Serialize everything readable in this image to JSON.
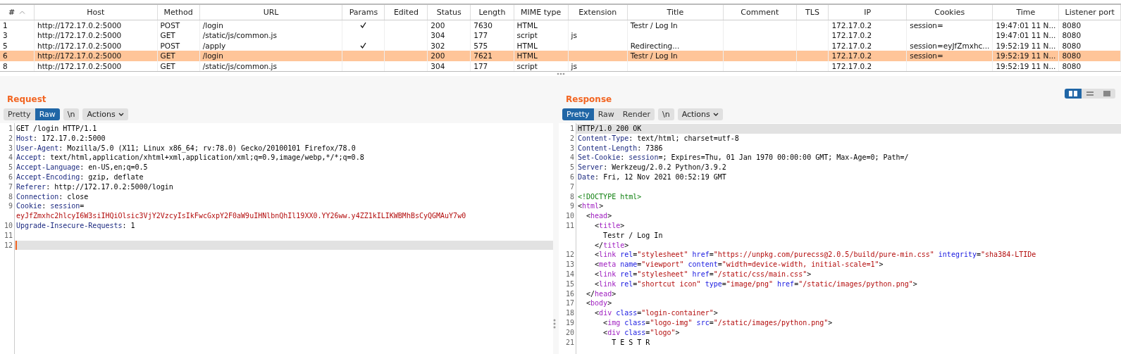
{
  "history_table": {
    "columns": [
      {
        "label": "#",
        "sorted": true
      },
      {
        "label": "Host"
      },
      {
        "label": "Method"
      },
      {
        "label": "URL"
      },
      {
        "label": "Params"
      },
      {
        "label": "Edited"
      },
      {
        "label": "Status"
      },
      {
        "label": "Length"
      },
      {
        "label": "MIME type"
      },
      {
        "label": "Extension"
      },
      {
        "label": "Title"
      },
      {
        "label": "Comment"
      },
      {
        "label": "TLS"
      },
      {
        "label": "IP"
      },
      {
        "label": "Cookies"
      },
      {
        "label": "Time"
      },
      {
        "label": "Listener port"
      }
    ],
    "rows": [
      {
        "selected": false,
        "number": "1",
        "host": "http://172.17.0.2:5000",
        "method": "POST",
        "url": "/login",
        "params": true,
        "status": "200",
        "length": "7630",
        "mime": "HTML",
        "title": "Testr / Log In",
        "ip": "172.17.0.2",
        "cookies": "session=",
        "time": "19:47:01 11 N...",
        "port": "8080"
      },
      {
        "selected": false,
        "number": "3",
        "host": "http://172.17.0.2:5000",
        "method": "GET",
        "url": "/static/js/common.js",
        "params": false,
        "status": "304",
        "length": "177",
        "mime": "script",
        "extension": "js",
        "ip": "172.17.0.2",
        "time": "19:47:01 11 N...",
        "port": "8080"
      },
      {
        "selected": false,
        "number": "5",
        "host": "http://172.17.0.2:5000",
        "method": "POST",
        "url": "/apply",
        "params": true,
        "status": "302",
        "length": "575",
        "mime": "HTML",
        "title": "Redirecting...",
        "ip": "172.17.0.2",
        "cookies": "session=eyJfZmxhc...",
        "time": "19:52:19 11 N...",
        "port": "8080"
      },
      {
        "selected": true,
        "number": "6",
        "host": "http://172.17.0.2:5000",
        "method": "GET",
        "url": "/login",
        "params": false,
        "status": "200",
        "length": "7621",
        "mime": "HTML",
        "title": "Testr / Log In",
        "ip": "172.17.0.2",
        "cookies": "session=",
        "time": "19:52:19 11 N...",
        "port": "8080"
      },
      {
        "selected": false,
        "number": "8",
        "host": "http://172.17.0.2:5000",
        "method": "GET",
        "url": "/static/js/common.js",
        "params": false,
        "status": "304",
        "length": "177",
        "mime": "script",
        "extension": "js",
        "ip": "172.17.0.2",
        "time": "19:52:19 11 N...",
        "port": "8080"
      }
    ]
  },
  "request": {
    "title": "Request",
    "view_tabs": [
      {
        "label": "Pretty",
        "selected": false
      },
      {
        "label": "Raw",
        "selected": true
      }
    ],
    "newline_button": "\\n",
    "actions_button": "Actions",
    "lines": [
      {
        "number": "1",
        "current": false,
        "segments": [
          {
            "kind": "plain",
            "text": "GET /login HTTP/1.1"
          }
        ]
      },
      {
        "number": "2",
        "current": false,
        "segments": [
          {
            "kind": "name",
            "text": "Host"
          },
          {
            "kind": "plain",
            "text": ": 172.17.0.2:5000"
          }
        ]
      },
      {
        "number": "3",
        "current": false,
        "segments": [
          {
            "kind": "name",
            "text": "User-Agent"
          },
          {
            "kind": "plain",
            "text": ": Mozilla/5.0 (X11; Linux x86_64; rv:78.0) Gecko/20100101 Firefox/78.0"
          }
        ]
      },
      {
        "number": "4",
        "current": false,
        "segments": [
          {
            "kind": "name",
            "text": "Accept"
          },
          {
            "kind": "plain",
            "text": ": text/html,application/xhtml+xml,application/xml;q=0.9,image/webp,*/*;q=0.8"
          }
        ]
      },
      {
        "number": "5",
        "current": false,
        "segments": [
          {
            "kind": "name",
            "text": "Accept-Language"
          },
          {
            "kind": "plain",
            "text": ": en-US,en;q=0.5"
          }
        ]
      },
      {
        "number": "6",
        "current": false,
        "segments": [
          {
            "kind": "name",
            "text": "Accept-Encoding"
          },
          {
            "kind": "plain",
            "text": ": gzip, deflate"
          }
        ]
      },
      {
        "number": "7",
        "current": false,
        "segments": [
          {
            "kind": "name",
            "text": "Referer"
          },
          {
            "kind": "plain",
            "text": ": http://172.17.0.2:5000/login"
          }
        ]
      },
      {
        "number": "8",
        "current": false,
        "segments": [
          {
            "kind": "name",
            "text": "Connection"
          },
          {
            "kind": "plain",
            "text": ": close"
          }
        ]
      },
      {
        "number": "9",
        "current": false,
        "segments": [
          {
            "kind": "name",
            "text": "Cookie"
          },
          {
            "kind": "plain",
            "text": ": "
          },
          {
            "kind": "name",
            "text": "session"
          },
          {
            "kind": "plain",
            "text": "="
          }
        ]
      },
      {
        "current": false,
        "segments": [
          {
            "kind": "value",
            "text": "eyJfZmxhc2hlcyI6W3siIHQiOlsic3VjY2VzcyIsIkFwcGxpY2F0aW9uIHNlbnQhIl19XX0.YY26ww.y4ZZ1kILIKWBMhBsCyQGMAuY7w0"
          }
        ]
      },
      {
        "number": "10",
        "current": false,
        "segments": [
          {
            "kind": "name",
            "text": "Upgrade-Insecure-Requests"
          },
          {
            "kind": "plain",
            "text": ": 1"
          }
        ]
      },
      {
        "number": "11",
        "current": false
      },
      {
        "number": "12",
        "current": true
      }
    ]
  },
  "response": {
    "title": "Response",
    "view_tabs": [
      {
        "label": "Pretty",
        "selected": true
      },
      {
        "label": "Raw",
        "selected": false
      },
      {
        "label": "Render",
        "selected": false
      }
    ],
    "newline_button": "\\n",
    "actions_button": "Actions",
    "layout_options": [
      {
        "kind": "columns",
        "selected": true
      },
      {
        "kind": "rows",
        "selected": false
      },
      {
        "kind": "single",
        "selected": false
      }
    ],
    "lines": [
      {
        "number": "1",
        "current": true,
        "segments": [
          {
            "kind": "plain",
            "text": "HTTP/1.0 200 OK"
          }
        ]
      },
      {
        "number": "2",
        "current": false,
        "segments": [
          {
            "kind": "name",
            "text": "Content-Type"
          },
          {
            "kind": "plain",
            "text": ": text/html; charset=utf-8"
          }
        ]
      },
      {
        "number": "3",
        "current": false,
        "segments": [
          {
            "kind": "name",
            "text": "Content-Length"
          },
          {
            "kind": "plain",
            "text": ": 7386"
          }
        ]
      },
      {
        "number": "4",
        "current": false,
        "segments": [
          {
            "kind": "name",
            "text": "Set-Cookie"
          },
          {
            "kind": "plain",
            "text": ": "
          },
          {
            "kind": "name",
            "text": "session"
          },
          {
            "kind": "plain",
            "text": "=; Expires=Thu, 01 Jan 1970 00:00:00 GMT; Max-Age=0; Path=/"
          }
        ]
      },
      {
        "number": "5",
        "current": false,
        "segments": [
          {
            "kind": "name",
            "text": "Server"
          },
          {
            "kind": "plain",
            "text": ": Werkzeug/2.0.2 Python/3.9.2"
          }
        ]
      },
      {
        "number": "6",
        "current": false,
        "segments": [
          {
            "kind": "name",
            "text": "Date"
          },
          {
            "kind": "plain",
            "text": ": Fri, 12 Nov 2021 00:52:19 GMT"
          }
        ]
      },
      {
        "number": "7",
        "current": false
      },
      {
        "number": "8",
        "current": false,
        "segments": [
          {
            "kind": "doctype",
            "text": "<!DOCTYPE html>"
          }
        ]
      },
      {
        "number": "9",
        "current": false,
        "segments": [
          {
            "kind": "plain",
            "text": "<"
          },
          {
            "kind": "tag",
            "text": "html"
          },
          {
            "kind": "plain",
            "text": ">"
          }
        ]
      },
      {
        "number": "10",
        "current": false,
        "segments": [
          {
            "kind": "plain",
            "text": "  <"
          },
          {
            "kind": "tag",
            "text": "head"
          },
          {
            "kind": "plain",
            "text": ">"
          }
        ]
      },
      {
        "number": "11",
        "current": false,
        "segments": [
          {
            "kind": "plain",
            "text": "    <"
          },
          {
            "kind": "tag",
            "text": "title"
          },
          {
            "kind": "plain",
            "text": ">"
          }
        ]
      },
      {
        "current": false,
        "segments": [
          {
            "kind": "plain",
            "text": "      Testr / Log In"
          }
        ]
      },
      {
        "current": false,
        "segments": [
          {
            "kind": "plain",
            "text": "    </"
          },
          {
            "kind": "tag",
            "text": "title"
          },
          {
            "kind": "plain",
            "text": ">"
          }
        ]
      },
      {
        "number": "12",
        "current": false,
        "segments": [
          {
            "kind": "plain",
            "text": "    <"
          },
          {
            "kind": "tag",
            "text": "link"
          },
          {
            "kind": "attr",
            "text": " rel"
          },
          {
            "kind": "plain",
            "text": "="
          },
          {
            "kind": "value",
            "text": "\"stylesheet\""
          },
          {
            "kind": "attr",
            "text": " href"
          },
          {
            "kind": "plain",
            "text": "="
          },
          {
            "kind": "value",
            "text": "\"https://unpkg.com/purecss@2.0.5/build/pure-min.css\""
          },
          {
            "kind": "attr",
            "text": " integrity"
          },
          {
            "kind": "plain",
            "text": "="
          },
          {
            "kind": "value",
            "text": "\"sha384-LTIDe"
          }
        ]
      },
      {
        "number": "13",
        "current": false,
        "segments": [
          {
            "kind": "plain",
            "text": "    <"
          },
          {
            "kind": "tag",
            "text": "meta"
          },
          {
            "kind": "attr",
            "text": " name"
          },
          {
            "kind": "plain",
            "text": "="
          },
          {
            "kind": "value",
            "text": "\"viewport\""
          },
          {
            "kind": "attr",
            "text": " content"
          },
          {
            "kind": "plain",
            "text": "="
          },
          {
            "kind": "value",
            "text": "\"width=device-width, initial-scale=1\""
          },
          {
            "kind": "plain",
            "text": ">"
          }
        ]
      },
      {
        "number": "14",
        "current": false,
        "segments": [
          {
            "kind": "plain",
            "text": "    <"
          },
          {
            "kind": "tag",
            "text": "link"
          },
          {
            "kind": "attr",
            "text": " rel"
          },
          {
            "kind": "plain",
            "text": "="
          },
          {
            "kind": "value",
            "text": "\"stylesheet\""
          },
          {
            "kind": "attr",
            "text": " href"
          },
          {
            "kind": "plain",
            "text": "="
          },
          {
            "kind": "value",
            "text": "\"/static/css/main.css\""
          },
          {
            "kind": "plain",
            "text": ">"
          }
        ]
      },
      {
        "number": "15",
        "current": false,
        "segments": [
          {
            "kind": "plain",
            "text": "    <"
          },
          {
            "kind": "tag",
            "text": "link"
          },
          {
            "kind": "attr",
            "text": " rel"
          },
          {
            "kind": "plain",
            "text": "="
          },
          {
            "kind": "value",
            "text": "\"shortcut icon\""
          },
          {
            "kind": "attr",
            "text": " type"
          },
          {
            "kind": "plain",
            "text": "="
          },
          {
            "kind": "value",
            "text": "\"image/png\""
          },
          {
            "kind": "attr",
            "text": " href"
          },
          {
            "kind": "plain",
            "text": "="
          },
          {
            "kind": "value",
            "text": "\"/static/images/python.png\""
          },
          {
            "kind": "plain",
            "text": ">"
          }
        ]
      },
      {
        "number": "16",
        "current": false,
        "segments": [
          {
            "kind": "plain",
            "text": "  </"
          },
          {
            "kind": "tag",
            "text": "head"
          },
          {
            "kind": "plain",
            "text": ">"
          }
        ]
      },
      {
        "number": "17",
        "current": false,
        "segments": [
          {
            "kind": "plain",
            "text": "  <"
          },
          {
            "kind": "tag",
            "text": "body"
          },
          {
            "kind": "plain",
            "text": ">"
          }
        ]
      },
      {
        "number": "18",
        "current": false,
        "segments": [
          {
            "kind": "plain",
            "text": "    <"
          },
          {
            "kind": "tag",
            "text": "div"
          },
          {
            "kind": "attr",
            "text": " class"
          },
          {
            "kind": "plain",
            "text": "="
          },
          {
            "kind": "value",
            "text": "\"login-container\""
          },
          {
            "kind": "plain",
            "text": ">"
          }
        ]
      },
      {
        "number": "19",
        "current": false,
        "segments": [
          {
            "kind": "plain",
            "text": "      <"
          },
          {
            "kind": "tag",
            "text": "img"
          },
          {
            "kind": "attr",
            "text": " class"
          },
          {
            "kind": "plain",
            "text": "="
          },
          {
            "kind": "value",
            "text": "\"logo-img\""
          },
          {
            "kind": "attr",
            "text": " src"
          },
          {
            "kind": "plain",
            "text": "="
          },
          {
            "kind": "value",
            "text": "\"/static/images/python.png\""
          },
          {
            "kind": "plain",
            "text": ">"
          }
        ]
      },
      {
        "number": "20",
        "current": false,
        "segments": [
          {
            "kind": "plain",
            "text": "      <"
          },
          {
            "kind": "tag",
            "text": "div"
          },
          {
            "kind": "attr",
            "text": " class"
          },
          {
            "kind": "plain",
            "text": "="
          },
          {
            "kind": "value",
            "text": "\"logo\""
          },
          {
            "kind": "plain",
            "text": ">"
          }
        ]
      },
      {
        "number": "21",
        "current": false,
        "segments": [
          {
            "kind": "plain",
            "text": "        T E S T R"
          }
        ]
      }
    ]
  }
}
